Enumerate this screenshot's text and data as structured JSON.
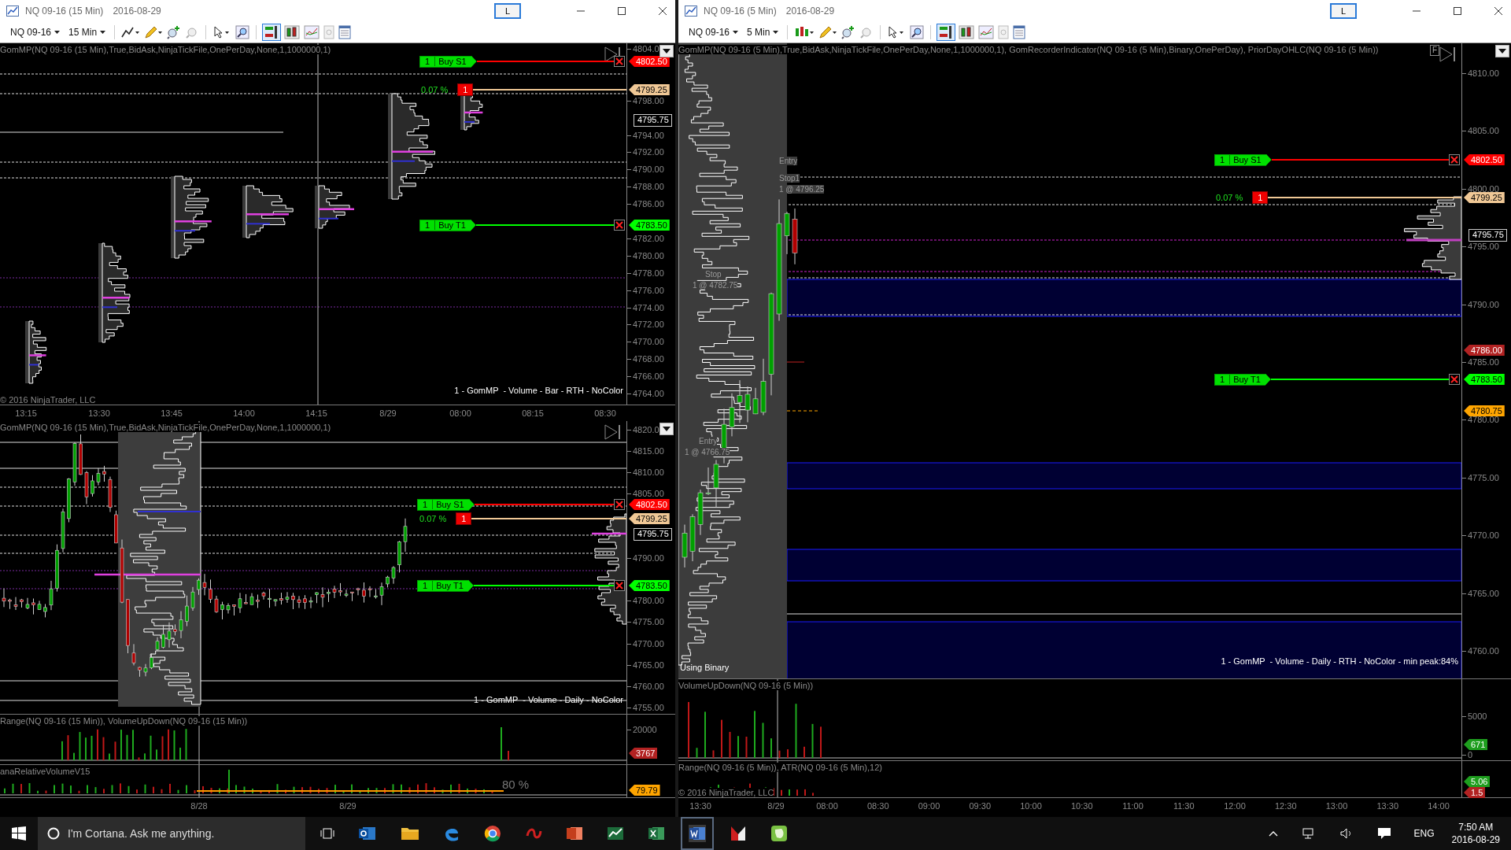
{
  "windows": [
    {
      "title": "NQ 09-16 (15 Min)",
      "date": "2016-08-29",
      "link_button": "L",
      "instrument": "NQ 09-16",
      "interval": "15 Min",
      "sections": [
        {
          "panels": [
            {
              "kind": "bar_profiles",
              "indicator": "GomMP(NQ 09-16 (15 Min),True,BidAsk,NinjaTickFile,OnePerDay,None,1,1000000,1)",
              "price_ticks": [
                "4804.0",
                "4798.00",
                "4794.00",
                "4792.00",
                "4790.00",
                "4788.00",
                "4786.00",
                "4782.00",
                "4780.00",
                "4778.00",
                "4776.00",
                "4774.00",
                "4772.00",
                "4770.00",
                "4768.00",
                "4766.00",
                "4764.00"
              ],
              "tags": [
                {
                  "text": "4802.50",
                  "color": "#ff0000"
                },
                {
                  "text": "4799.25",
                  "color": "#f0c896"
                },
                {
                  "text": "4795.75",
                  "color": "#000000"
                },
                {
                  "text": "4783.50",
                  "color": "#00ff00"
                }
              ],
              "orders": [
                {
                  "kind": "bracket",
                  "quantity": "1",
                  "label": "Buy S1",
                  "color": "#ff0000"
                },
                {
                  "kind": "position",
                  "percent": "0.07 %",
                  "quantity": "1",
                  "color": "#f0c896"
                },
                {
                  "kind": "bracket",
                  "quantity": "1",
                  "label": "Buy T1",
                  "color": "#00ff00"
                }
              ],
              "footer": "1 - GomMP  - Volume - Bar - RTH - NoColor",
              "copyright": "© 2016 NinjaTrader, LLC"
            }
          ],
          "time_ticks": [
            "13:15",
            "13:30",
            "13:45",
            "14:00",
            "14:15",
            "8/29",
            "08:00",
            "08:15",
            "08:30"
          ]
        },
        {
          "panels": [
            {
              "kind": "daily_profile",
              "indicator": "GomMP(NQ 09-16 (15 Min),True,BidAsk,NinjaTickFile,OnePerDay,None,1,1000000,1)",
              "price_ticks": [
                "4820.0",
                "4815.00",
                "4810.00",
                "4805.00",
                "4790.00",
                "4780.00",
                "4775.00",
                "4770.00",
                "4765.00",
                "4760.00",
                "4755.00"
              ],
              "tags": [
                {
                  "text": "4802.50",
                  "color": "#ff0000"
                },
                {
                  "text": "4799.25",
                  "color": "#f0c896"
                },
                {
                  "text": "4795.75",
                  "color": "#000000"
                },
                {
                  "text": "4783.50",
                  "color": "#00ff00"
                }
              ],
              "orders": [
                {
                  "kind": "bracket",
                  "quantity": "1",
                  "label": "Buy S1",
                  "color": "#ff0000"
                },
                {
                  "kind": "position",
                  "percent": "0.07 %",
                  "quantity": "1",
                  "color": "#f0c896"
                },
                {
                  "kind": "bracket",
                  "quantity": "1",
                  "label": "Buy T1",
                  "color": "#00ff00"
                }
              ],
              "footer": "1 - GomMP  - Volume - Daily - NoColor"
            },
            {
              "kind": "range_volume",
              "indicator": "Range(NQ 09-16 (15 Min)), VolumeUpDown(NQ 09-16 (15 Min))",
              "price_ticks": [
                "20000"
              ],
              "tags": [
                {
                  "text": "3767",
                  "color": "#b22222"
                }
              ]
            },
            {
              "kind": "relative_volume",
              "indicator": "anaRelativeVolumeV15",
              "reading": "80 %",
              "tags": [
                {
                  "text": "79.79",
                  "color": "#ffa500"
                }
              ]
            }
          ],
          "time_ticks": [
            "8/28",
            "8/29"
          ]
        }
      ]
    },
    {
      "title": "NQ 09-16 (5 Min)",
      "date": "2016-08-29",
      "link_button": "L",
      "instrument": "NQ 09-16",
      "interval": "5 Min",
      "sections": [
        {
          "panels": [
            {
              "kind": "session_profile",
              "indicator": "GomMP(NQ 09-16 (5 Min),True,BidAsk,NinjaTickFile,OnePerDay,None,1,1000000,1), GomRecorderIndicator(NQ 09-16 (5 Min),Binary,OnePerDay), PriorDayOHLC(NQ 09-16 (5 Min))",
              "f_button": "F",
              "price_ticks": [
                "4810.00",
                "4805.00",
                "4800.00",
                "4795.00",
                "4790.00",
                "4785.00",
                "4780.00",
                "4775.00",
                "4770.00",
                "4765.00",
                "4760.00"
              ],
              "tags": [
                {
                  "text": "4802.50",
                  "color": "#ff0000"
                },
                {
                  "text": "4799.25",
                  "color": "#f0c896"
                },
                {
                  "text": "4795.75",
                  "color": "#000000"
                },
                {
                  "text": "4786.00",
                  "color": "#b22222"
                },
                {
                  "text": "4783.50",
                  "color": "#00ff00"
                },
                {
                  "text": "4780.75",
                  "color": "#ffa500"
                }
              ],
              "orders": [
                {
                  "kind": "bracket",
                  "quantity": "1",
                  "label": "Buy S1",
                  "color": "#ff0000"
                },
                {
                  "kind": "position",
                  "percent": "0.07 %",
                  "quantity": "1",
                  "color": "#f0c896"
                },
                {
                  "kind": "bracket",
                  "quantity": "1",
                  "label": "Buy T1",
                  "color": "#00ff00"
                }
              ],
              "trade_labels": [
                "Entry",
                "Stop1",
                "1 @ 4796.25",
                "Stop",
                "1 @ 4782.75",
                "Entry",
                "1 @ 4766.75"
              ],
              "status": "Using Binary",
              "footer": "1 - GomMP  - Volume - Daily - RTH - NoColor - min peak:84%"
            },
            {
              "kind": "volume",
              "indicator": "VolumeUpDown(NQ 09-16 (5 Min))",
              "price_ticks": [
                "5000",
                "0"
              ],
              "tags": [
                {
                  "text": "671",
                  "color": "#1e9e1e"
                }
              ]
            },
            {
              "kind": "range_atr",
              "indicator": "Range(NQ 09-16 (5 Min)), ATR(NQ 09-16 (5 Min),12)",
              "copyright": "© 2016 NinjaTrader, LLC",
              "tags": [
                {
                  "text": "5.06",
                  "color": "#1e9e1e"
                },
                {
                  "text": "1.5",
                  "color": "#b22222"
                }
              ]
            }
          ],
          "time_ticks": [
            "13:30",
            "8/29",
            "08:00",
            "08:30",
            "09:00",
            "09:30",
            "10:00",
            "10:30",
            "11:00",
            "11:30",
            "12:00",
            "12:30",
            "13:00",
            "13:30",
            "14:00"
          ]
        }
      ]
    }
  ],
  "taskbar": {
    "search": {
      "placeholder": "I'm Cortana. Ask me anything."
    },
    "language": "ENG",
    "time": "7:50 AM",
    "date": "2016-08-29"
  }
}
